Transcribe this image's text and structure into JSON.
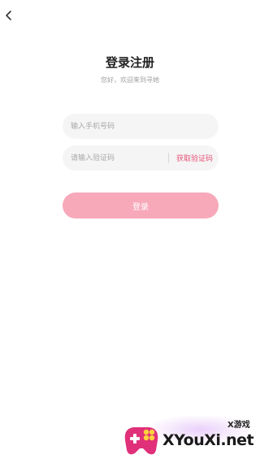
{
  "header": {
    "back_icon": "chevron-left-icon",
    "title": "登录注册",
    "subtitle": "您好，欢迎来到寻她"
  },
  "form": {
    "phone_placeholder": "输入手机号码",
    "phone_value": "",
    "code_placeholder": "请输入验证码",
    "code_value": "",
    "get_code_label": "获取验证码",
    "login_label": "登录"
  },
  "watermark": {
    "brand": "XYouXi.net",
    "sub": "X游戏"
  },
  "colors": {
    "accent": "#e8547a",
    "button": "#f7a9ba",
    "field_bg": "#f5f5f5"
  }
}
